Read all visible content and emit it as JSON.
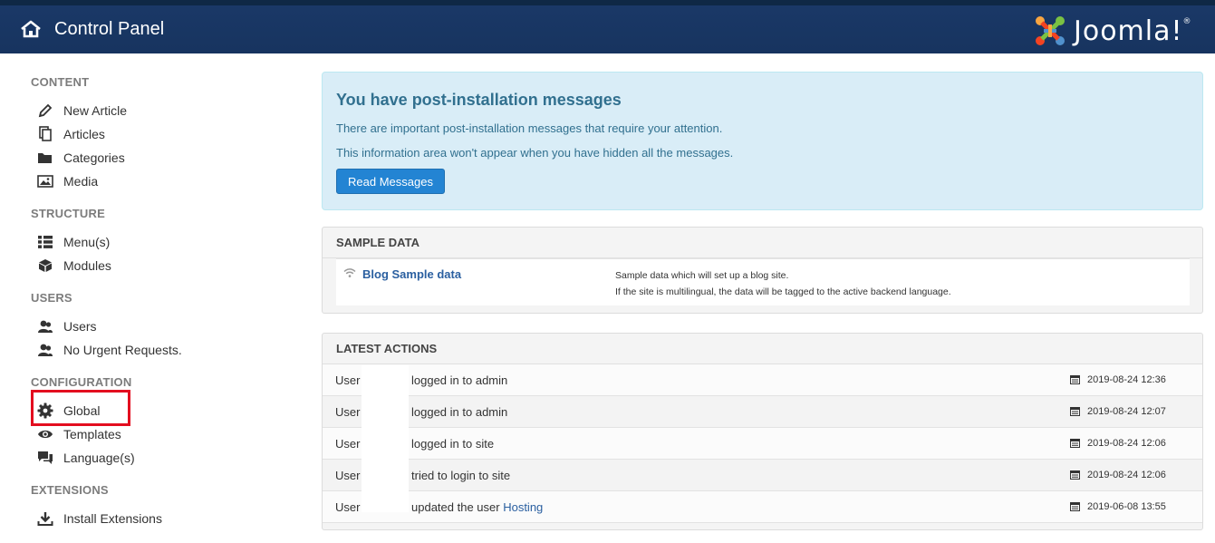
{
  "header": {
    "title": "Control Panel",
    "logo_text": "Joomla!",
    "logo_mark": "®"
  },
  "sidebar": {
    "sections": [
      {
        "title": "CONTENT",
        "items": [
          {
            "label": "New Article",
            "icon": "pencil-icon"
          },
          {
            "label": "Articles",
            "icon": "copy-icon"
          },
          {
            "label": "Categories",
            "icon": "folder-icon"
          },
          {
            "label": "Media",
            "icon": "image-icon"
          }
        ]
      },
      {
        "title": "STRUCTURE",
        "items": [
          {
            "label": "Menu(s)",
            "icon": "list-icon"
          },
          {
            "label": "Modules",
            "icon": "cube-icon"
          }
        ]
      },
      {
        "title": "USERS",
        "items": [
          {
            "label": "Users",
            "icon": "users-icon"
          },
          {
            "label": "No Urgent Requests.",
            "icon": "users-icon"
          }
        ]
      },
      {
        "title": "CONFIGURATION",
        "items": [
          {
            "label": "Global",
            "icon": "gear-icon"
          },
          {
            "label": "Templates",
            "icon": "eye-icon"
          },
          {
            "label": "Language(s)",
            "icon": "comments-icon"
          }
        ]
      },
      {
        "title": "EXTENSIONS",
        "items": [
          {
            "label": "Install Extensions",
            "icon": "download-icon"
          }
        ]
      }
    ]
  },
  "alert": {
    "title": "You have post-installation messages",
    "line1": "There are important post-installation messages that require your attention.",
    "line2": "This information area won't appear when you have hidden all the messages.",
    "button": "Read Messages"
  },
  "sample_data": {
    "heading": "SAMPLE DATA",
    "name": "Blog Sample data",
    "desc1": "Sample data which will set up a blog site.",
    "desc2": "If the site is multilingual, the data will be tagged to the active backend language."
  },
  "latest": {
    "heading": "LATEST ACTIONS",
    "rows": [
      {
        "user": "User",
        "text": "logged in to admin",
        "link": "",
        "date": "2019-08-24 12:36"
      },
      {
        "user": "User",
        "text": "logged in to admin",
        "link": "",
        "date": "2019-08-24 12:07"
      },
      {
        "user": "User",
        "text": "logged in to site",
        "link": "",
        "date": "2019-08-24 12:06"
      },
      {
        "user": "User",
        "text": "tried to login to site",
        "link": "",
        "date": "2019-08-24 12:06"
      },
      {
        "user": "User",
        "text": "updated the user ",
        "link": "Hosting",
        "date": "2019-06-08 13:55"
      }
    ]
  },
  "colors": {
    "header": "#17345f",
    "accent": "#2384d3",
    "highlight": "#e30e1f"
  }
}
